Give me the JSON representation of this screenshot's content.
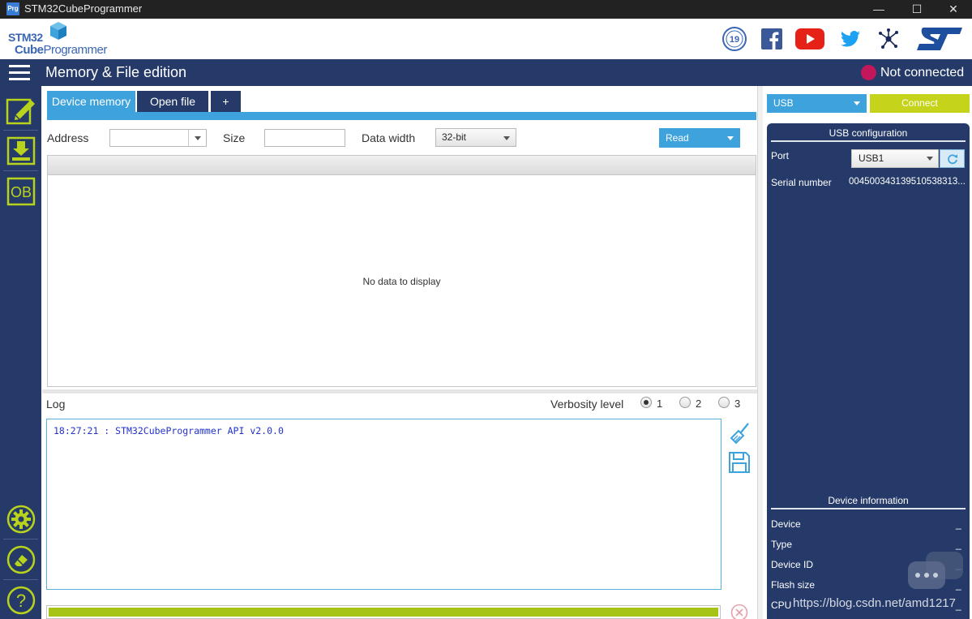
{
  "window": {
    "title": "STM32CubeProgrammer",
    "app_icon_text": "Prg",
    "minimize": "—",
    "maximize": "☐",
    "close": "✕"
  },
  "brand": {
    "logo_line1": "STM32",
    "logo_line2_bold": "Cube",
    "logo_line2_light": "Programmer",
    "badge_text": "19",
    "icons": [
      "anniversary-badge-icon",
      "facebook-icon",
      "youtube-icon",
      "twitter-icon",
      "network-icon",
      "st-logo-icon"
    ]
  },
  "header": {
    "page_title": "Memory & File edition",
    "connection_status": "Not connected",
    "status_color": "#c2185b"
  },
  "sidebar": {
    "items": [
      {
        "name": "memory-edit",
        "icon": "edit-icon"
      },
      {
        "name": "download",
        "icon": "download-icon"
      },
      {
        "name": "option-bytes",
        "icon": "ob-icon",
        "label": "OB"
      },
      {
        "name": "settings",
        "icon": "gear-icon"
      },
      {
        "name": "erase",
        "icon": "eraser-icon"
      },
      {
        "name": "help",
        "icon": "help-icon",
        "label": "?"
      }
    ]
  },
  "tabs": [
    {
      "label": "Device memory",
      "active": true
    },
    {
      "label": "Open file",
      "active": false
    },
    {
      "label": "+",
      "active": false
    }
  ],
  "toolbar": {
    "address_label": "Address",
    "address_value": "",
    "size_label": "Size",
    "size_value": "",
    "data_width_label": "Data width",
    "data_width_value": "32-bit",
    "read_label": "Read"
  },
  "memory_table": {
    "empty_text": "No data to display"
  },
  "log": {
    "label": "Log",
    "verbosity_label": "Verbosity level",
    "levels": [
      "1",
      "2",
      "3"
    ],
    "selected_level": "1",
    "lines": [
      "18:27:21 : STM32CubeProgrammer API v2.0.0"
    ]
  },
  "progress": {
    "fraction": 1.0
  },
  "connection": {
    "interface_value": "USB",
    "connect_label": "Connect",
    "usb_config_title": "USB configuration",
    "port_label": "Port",
    "port_value": "USB1",
    "serial_label": "Serial number",
    "serial_value": "004500343139510538313...",
    "device_info_title": "Device information",
    "device_info": [
      {
        "label": "Device",
        "value": "_"
      },
      {
        "label": "Type",
        "value": "_"
      },
      {
        "label": "Device ID",
        "value": "_"
      },
      {
        "label": "Flash size",
        "value": "_"
      },
      {
        "label": "CPU",
        "value": "_"
      }
    ]
  },
  "watermark": {
    "text": "https://blog.csdn.net/amd1217"
  },
  "colors": {
    "navy": "#253a68",
    "accent_blue": "#3ea3dc",
    "accent_green": "#c5d31a",
    "icon_green": "#b9d21b"
  }
}
